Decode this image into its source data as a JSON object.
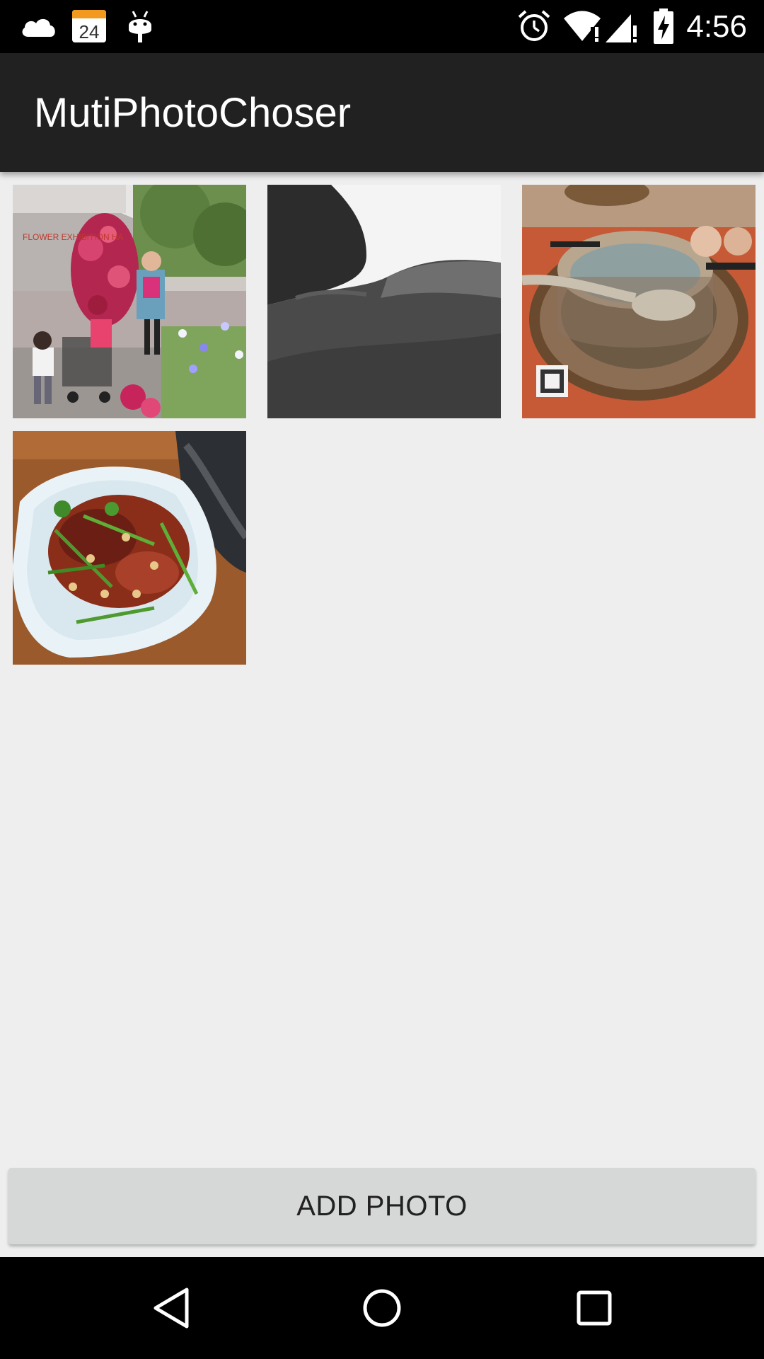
{
  "status_bar": {
    "time": "4:56",
    "calendar_day": "24",
    "icons": [
      "cloud-icon",
      "calendar-icon",
      "android-debug-icon",
      "alarm-icon",
      "wifi-icon",
      "cell-signal-icon",
      "battery-charging-icon"
    ]
  },
  "app_bar": {
    "title": "MutiPhotoChoser"
  },
  "photos": [
    {
      "name": "photo-flower-exhibition",
      "sign_text": "FLOWER EXHIBITION HA"
    },
    {
      "name": "photo-gray-fabric"
    },
    {
      "name": "photo-bowl-and-spoon"
    },
    {
      "name": "photo-spicy-beef-dish"
    }
  ],
  "add_button": {
    "label": "ADD PHOTO"
  },
  "nav_bar": {
    "buttons": [
      "back-icon",
      "home-icon",
      "recents-icon"
    ]
  },
  "colors": {
    "status_bar_bg": "#000000",
    "app_bar_bg": "#212121",
    "content_bg": "#eeeeee",
    "button_bg": "#d6d7d7",
    "nav_bar_bg": "#000000"
  }
}
